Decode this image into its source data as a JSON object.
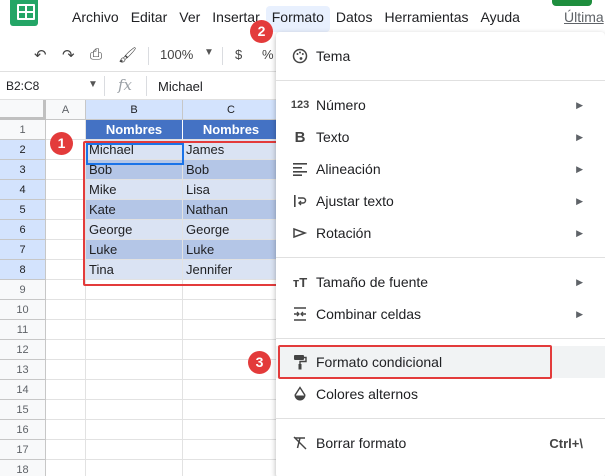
{
  "menubar": {
    "items": [
      "Archivo",
      "Editar",
      "Ver",
      "Insertar",
      "Formato",
      "Datos",
      "Herramientas",
      "Ayuda"
    ],
    "last_edit": "Última"
  },
  "toolbar": {
    "zoom": "100%",
    "currency": "$",
    "percent": "%"
  },
  "formula_bar": {
    "name_box": "B2:C8",
    "fx": "fx",
    "value": "Michael"
  },
  "grid": {
    "columns": [
      "A",
      "B",
      "C"
    ],
    "rows": [
      "1",
      "2",
      "3",
      "4",
      "5",
      "6",
      "7",
      "8",
      "9",
      "10",
      "11",
      "12",
      "13",
      "14",
      "15",
      "16",
      "17",
      "18"
    ],
    "header": [
      "Nombres",
      "Nombres"
    ],
    "data": [
      [
        "Michael",
        "James"
      ],
      [
        "Bob",
        "Bob"
      ],
      [
        "Mike",
        "Lisa"
      ],
      [
        "Kate",
        "Nathan"
      ],
      [
        "George",
        "George"
      ],
      [
        "Luke",
        "Luke"
      ],
      [
        "Tina",
        "Jennifer"
      ]
    ]
  },
  "callouts": [
    "1",
    "2",
    "3"
  ],
  "format_menu": {
    "items": [
      {
        "label": "Tema",
        "icon": "palette-icon"
      },
      {
        "label": "Número",
        "icon": "number-format-icon",
        "submenu": true
      },
      {
        "label": "Texto",
        "icon": "bold-icon",
        "submenu": true
      },
      {
        "label": "Alineación",
        "icon": "align-icon",
        "submenu": true
      },
      {
        "label": "Ajustar texto",
        "icon": "wrap-text-icon",
        "submenu": true
      },
      {
        "label": "Rotación",
        "icon": "rotate-text-icon",
        "submenu": true
      },
      {
        "label": "Tamaño de fuente",
        "icon": "font-size-icon",
        "submenu": true
      },
      {
        "label": "Combinar celdas",
        "icon": "merge-cells-icon",
        "submenu": true
      },
      {
        "label": "Formato condicional",
        "icon": "paint-roller-icon"
      },
      {
        "label": "Colores alternos",
        "icon": "color-drop-icon"
      },
      {
        "label": "Borrar formato",
        "icon": "clear-format-icon",
        "shortcut": "Ctrl+\\"
      }
    ]
  },
  "colors": {
    "header_blue": "#4472c4",
    "light_blue": "#dae3f3",
    "mid_blue": "#b4c6e7",
    "callout_red": "#e33b3b",
    "sheets_green": "#23a566"
  }
}
